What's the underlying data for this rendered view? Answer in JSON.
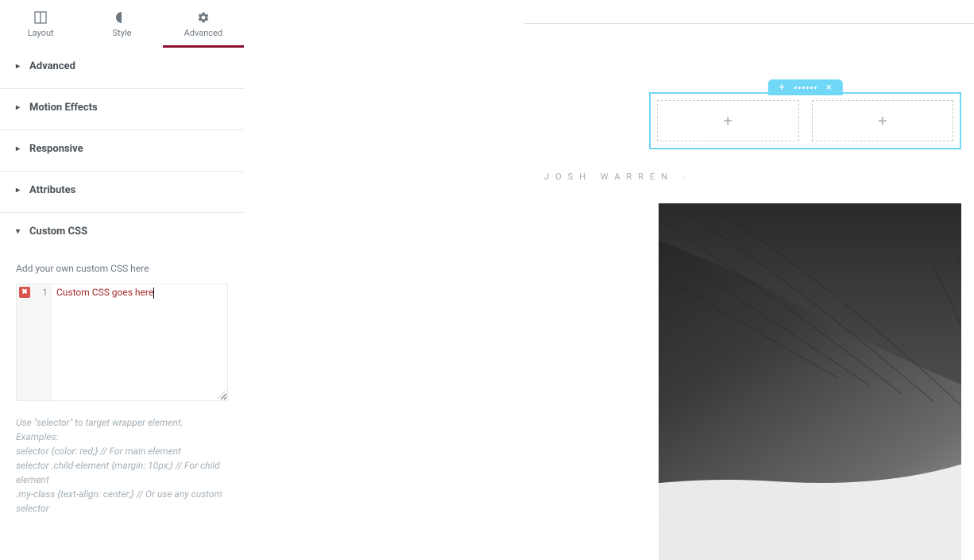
{
  "tabs": {
    "layout": "Layout",
    "style": "Style",
    "advanced": "Advanced"
  },
  "sections": {
    "advanced": "Advanced",
    "motion": "Motion Effects",
    "responsive": "Responsive",
    "attributes": "Attributes",
    "customcss": "Custom CSS"
  },
  "customcss": {
    "label": "Add your own custom CSS here",
    "line": "1",
    "code": "Custom CSS goes here",
    "hint1": "Use \"selector\" to target wrapper element.",
    "hint2": "Examples:",
    "hint3": "selector {color: red;} // For main element",
    "hint4": "selector .child-element {margin: 10px;} // For child element",
    "hint5": ".my-class {text-align: center;} // Or use any custom selector"
  },
  "preview": {
    "author": "· Josh Warren ·"
  },
  "icons": {
    "plus": "+",
    "close": "×",
    "error": "✖",
    "caret_left": "‹",
    "caret_right": "▸",
    "caret_down": "▾"
  }
}
